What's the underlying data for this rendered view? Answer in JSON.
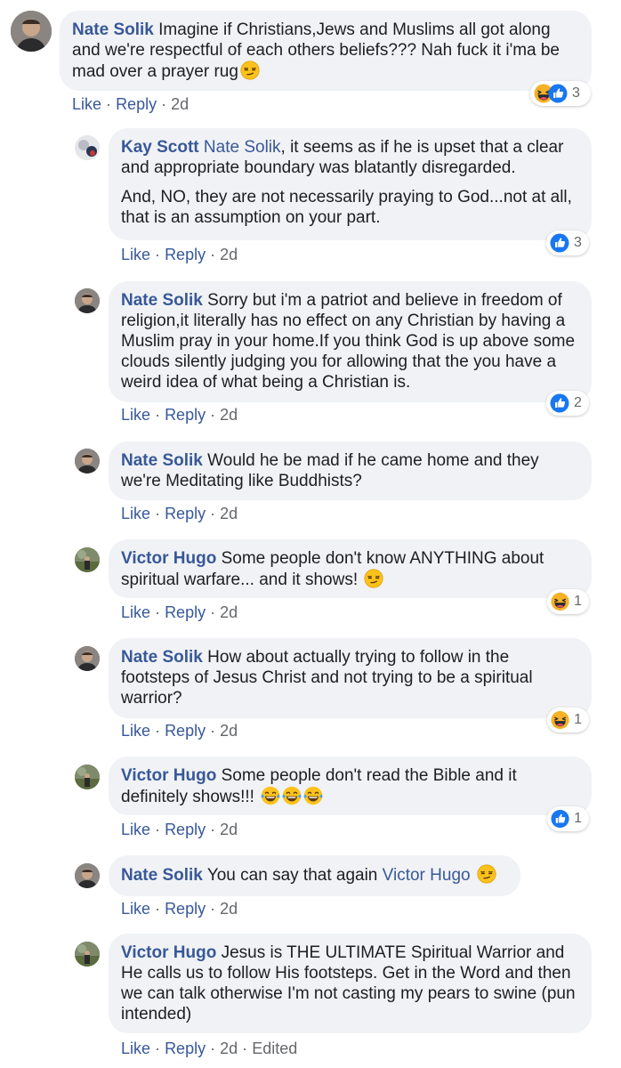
{
  "comments": [
    {
      "author": "Nate Solik",
      "paragraphs": [
        "Imagine if Christians,Jews and Muslims all got along and we're respectful of each others beliefs??? Nah fuck it i'ma be mad over a prayer rug"
      ],
      "like": "Like",
      "reply": "Reply",
      "time": "2d",
      "reaction_count": "3"
    },
    {
      "author": "Kay Scott",
      "mention": "Nate Solik",
      "paragraphs": [
        ", it seems as if he is upset that a clear and appropriate boundary was blatantly disregarded.",
        "And, NO, they are not necessarily praying to God...not at all, that is an assumption on your part."
      ],
      "like": "Like",
      "reply": "Reply",
      "time": "2d",
      "reaction_count": "3"
    },
    {
      "author": "Nate Solik",
      "paragraphs": [
        "Sorry but i'm a patriot and believe in freedom of religion,it literally has no effect on any Christian by having a Muslim pray in your home.If you think God is up above some clouds silently judging you for allowing that the you have a weird idea of what being a Christian is."
      ],
      "like": "Like",
      "reply": "Reply",
      "time": "2d",
      "reaction_count": "2"
    },
    {
      "author": "Nate Solik",
      "paragraphs": [
        "Would he be mad if he came home and they we're Meditating like Buddhists?"
      ],
      "like": "Like",
      "reply": "Reply",
      "time": "2d"
    },
    {
      "author": "Victor Hugo",
      "paragraphs": [
        "Some people don't know ANYTHING about spiritual warfare... and it shows!"
      ],
      "like": "Like",
      "reply": "Reply",
      "time": "2d",
      "reaction_count": "1"
    },
    {
      "author": "Nate Solik",
      "paragraphs": [
        "How about actually trying to follow in the footsteps of Jesus Christ and not trying to be a spiritual warrior?"
      ],
      "like": "Like",
      "reply": "Reply",
      "time": "2d",
      "reaction_count": "1"
    },
    {
      "author": "Victor Hugo",
      "paragraphs": [
        "Some people don't read the Bible and it definitely shows!!!"
      ],
      "like": "Like",
      "reply": "Reply",
      "time": "2d",
      "reaction_count": "1"
    },
    {
      "author": "Nate Solik",
      "paragraphs": [
        "You can say that again"
      ],
      "mention_after": "Victor Hugo",
      "like": "Like",
      "reply": "Reply",
      "time": "2d"
    },
    {
      "author": "Victor Hugo",
      "paragraphs": [
        "Jesus is THE ULTIMATE Spiritual Warrior and He calls us to follow His footsteps. Get in the Word and then we can talk otherwise I'm not casting my pears to swine (pun intended)"
      ],
      "like": "Like",
      "reply": "Reply",
      "time": "2d",
      "edited": "Edited"
    }
  ],
  "separator": "·",
  "colors": {
    "link": "#385898",
    "meta": "#65676b",
    "bubble": "#f0f2f5",
    "like_blue": "#1877f2",
    "haha_yellow": "#f7b125"
  },
  "icons": [
    "haha-icon",
    "like-icon",
    "smirk-emoji",
    "laughing-tears-emoji"
  ]
}
